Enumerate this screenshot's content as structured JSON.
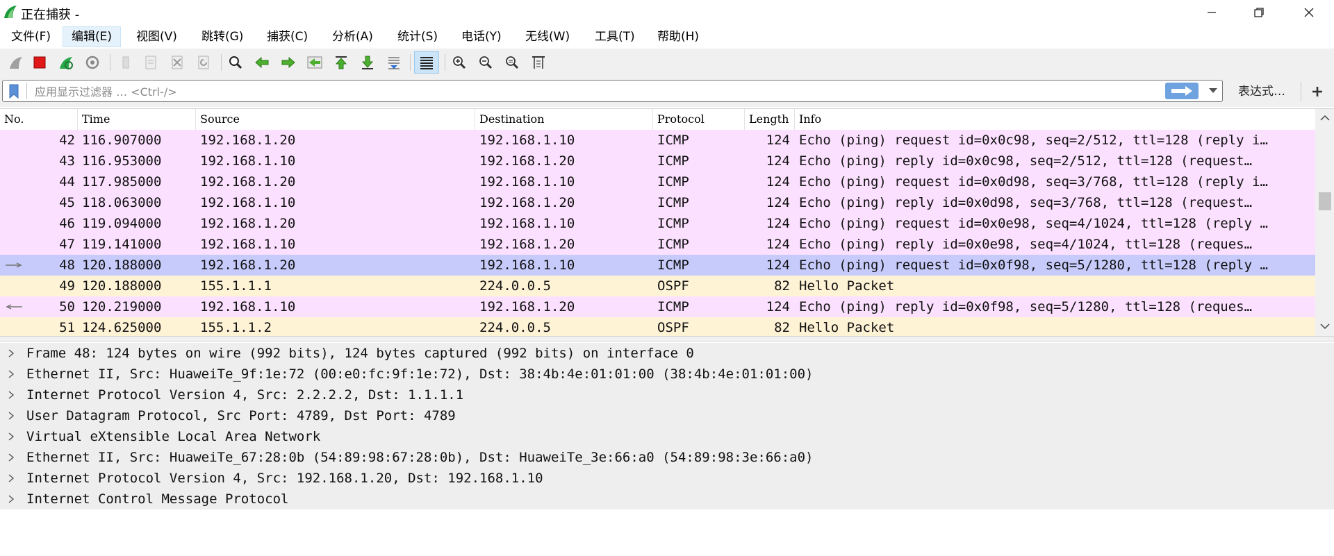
{
  "window": {
    "title": "正在捕获 -",
    "icons": [
      "wireshark-fin-icon",
      "minimize-icon",
      "restore-icon",
      "close-icon"
    ]
  },
  "menu": {
    "items": [
      "文件(F)",
      "编辑(E)",
      "视图(V)",
      "跳转(G)",
      "捕获(C)",
      "分析(A)",
      "统计(S)",
      "电话(Y)",
      "无线(W)",
      "工具(T)",
      "帮助(H)"
    ],
    "active_index": 1
  },
  "toolbar": {
    "icons": [
      "start-capture-icon",
      "stop-capture-icon",
      "restart-capture-icon",
      "capture-options-icon",
      "open-file-icon",
      "save-file-icon",
      "close-file-icon",
      "reload-file-icon",
      "find-packet-icon",
      "go-back-icon",
      "go-forward-icon",
      "go-to-packet-icon",
      "go-first-icon",
      "go-last-icon",
      "auto-scroll-icon",
      "colorize-icon",
      "zoom-in-icon",
      "zoom-out-icon",
      "zoom-reset-icon",
      "resize-columns-icon"
    ]
  },
  "filter": {
    "placeholder": "应用显示过滤器 … <Ctrl-/>",
    "value": "",
    "expression_label": "表达式…",
    "add_label": "+"
  },
  "packet_list": {
    "columns": [
      "No.",
      "Time",
      "Source",
      "Destination",
      "Protocol",
      "Length",
      "Info"
    ],
    "rows": [
      {
        "no": "42",
        "time": "116.907000",
        "src": "192.168.1.20",
        "dst": "192.168.1.10",
        "proto": "ICMP",
        "len": "124",
        "info": "Echo (ping) request  id=0x0c98, seq=2/512, ttl=128 (reply i…",
        "color": "#fce0ff",
        "marker": ""
      },
      {
        "no": "43",
        "time": "116.953000",
        "src": "192.168.1.10",
        "dst": "192.168.1.20",
        "proto": "ICMP",
        "len": "124",
        "info": "Echo (ping) reply    id=0x0c98, seq=2/512, ttl=128 (request…",
        "color": "#fce0ff",
        "marker": ""
      },
      {
        "no": "44",
        "time": "117.985000",
        "src": "192.168.1.20",
        "dst": "192.168.1.10",
        "proto": "ICMP",
        "len": "124",
        "info": "Echo (ping) request  id=0x0d98, seq=3/768, ttl=128 (reply i…",
        "color": "#fce0ff",
        "marker": ""
      },
      {
        "no": "45",
        "time": "118.063000",
        "src": "192.168.1.10",
        "dst": "192.168.1.20",
        "proto": "ICMP",
        "len": "124",
        "info": "Echo (ping) reply    id=0x0d98, seq=3/768, ttl=128 (request…",
        "color": "#fce0ff",
        "marker": ""
      },
      {
        "no": "46",
        "time": "119.094000",
        "src": "192.168.1.20",
        "dst": "192.168.1.10",
        "proto": "ICMP",
        "len": "124",
        "info": "Echo (ping) request  id=0x0e98, seq=4/1024, ttl=128 (reply …",
        "color": "#fce0ff",
        "marker": ""
      },
      {
        "no": "47",
        "time": "119.141000",
        "src": "192.168.1.10",
        "dst": "192.168.1.20",
        "proto": "ICMP",
        "len": "124",
        "info": "Echo (ping) reply    id=0x0e98, seq=4/1024, ttl=128 (reques…",
        "color": "#fce0ff",
        "marker": ""
      },
      {
        "no": "48",
        "time": "120.188000",
        "src": "192.168.1.20",
        "dst": "192.168.1.10",
        "proto": "ICMP",
        "len": "124",
        "info": "Echo (ping) request  id=0x0f98, seq=5/1280, ttl=128 (reply …",
        "color": "#c6cbfb",
        "marker": "right"
      },
      {
        "no": "49",
        "time": "120.188000",
        "src": "155.1.1.1",
        "dst": "224.0.0.5",
        "proto": "OSPF",
        "len": "82",
        "info": "Hello Packet",
        "color": "#fff3d6",
        "marker": ""
      },
      {
        "no": "50",
        "time": "120.219000",
        "src": "192.168.1.10",
        "dst": "192.168.1.20",
        "proto": "ICMP",
        "len": "124",
        "info": "Echo (ping) reply    id=0x0f98, seq=5/1280, ttl=128 (reques…",
        "color": "#fce0ff",
        "marker": "left"
      },
      {
        "no": "51",
        "time": "124.625000",
        "src": "155.1.1.2",
        "dst": "224.0.0.5",
        "proto": "OSPF",
        "len": "82",
        "info": "Hello Packet",
        "color": "#fff3d6",
        "marker": ""
      }
    ]
  },
  "details": {
    "rows": [
      "Frame 48: 124 bytes on wire (992 bits), 124 bytes captured (992 bits) on interface 0",
      "Ethernet II, Src: HuaweiTe_9f:1e:72 (00:e0:fc:9f:1e:72), Dst: 38:4b:4e:01:01:00 (38:4b:4e:01:01:00)",
      "Internet Protocol Version 4, Src: 2.2.2.2, Dst: 1.1.1.1",
      "User Datagram Protocol, Src Port: 4789, Dst Port: 4789",
      "Virtual eXtensible Local Area Network",
      "Ethernet II, Src: HuaweiTe_67:28:0b (54:89:98:67:28:0b), Dst: HuaweiTe_3e:66:a0 (54:89:98:3e:66:a0)",
      "Internet Protocol Version 4, Src: 192.168.1.20, Dst: 192.168.1.10",
      "Internet Control Message Protocol"
    ]
  }
}
